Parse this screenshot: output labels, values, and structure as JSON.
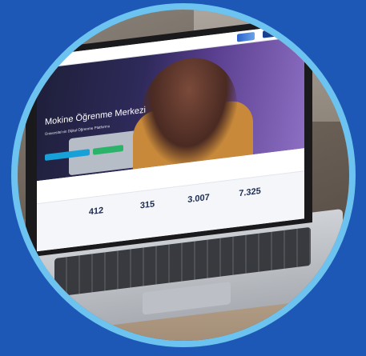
{
  "site": {
    "hero": {
      "title": "Mokine Öğrenme Merkezi",
      "subtitle": "Üniversite'nin Dijital Öğrenme Platformu",
      "cta_primary": "",
      "cta_secondary": ""
    },
    "features": [
      {
        "text": ""
      },
      {
        "text": ""
      },
      {
        "text": ""
      }
    ],
    "stats": [
      {
        "value": "412",
        "label": ""
      },
      {
        "value": "315",
        "label": ""
      },
      {
        "value": "3.007",
        "label": ""
      },
      {
        "value": "7.325",
        "label": ""
      }
    ]
  },
  "colors": {
    "background": "#1d58b6",
    "ring": "#6cc3ef",
    "cta_primary": "#18a0d8",
    "cta_secondary": "#2cb36a"
  }
}
